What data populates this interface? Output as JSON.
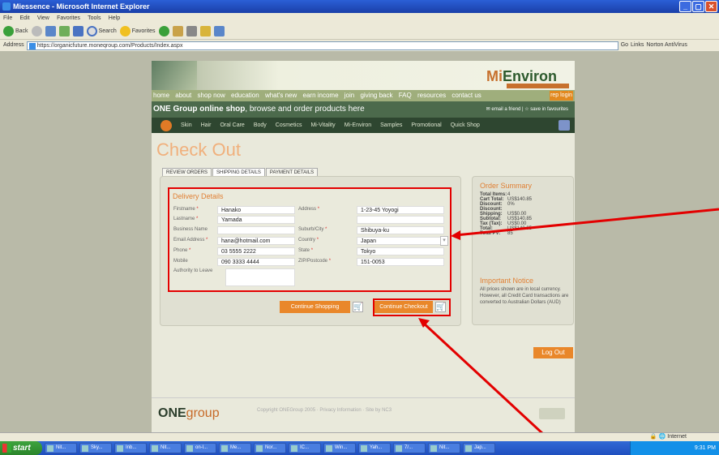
{
  "window": {
    "title": "Miessence - Microsoft Internet Explorer",
    "controls": [
      "_",
      "▢",
      "✕"
    ]
  },
  "menu": [
    "File",
    "Edit",
    "View",
    "Favorites",
    "Tools",
    "Help"
  ],
  "toolbar": {
    "back": "Back",
    "search": "Search",
    "favorites": "Favorites"
  },
  "address": {
    "label": "Address",
    "url": "https://organicfuture.moneqroup.com/Products/Index.aspx",
    "go": "Go",
    "links": "Links",
    "norton": "Norton AntiVirus"
  },
  "site": {
    "logo_mi": "Mi",
    "logo_rest": "Environ",
    "nav": [
      "home",
      "about",
      "shop now",
      "education",
      "what's new",
      "earn income",
      "join",
      "giving back",
      "FAQ",
      "resources",
      "contact us"
    ],
    "rep_login": "rep login",
    "shop_title": "ONE Group online shop",
    "shop_sub": ", browse and order products here",
    "shop_links": "✉ email a friend | ☆ save in favourites",
    "categories": [
      "Skin",
      "Hair",
      "Oral Care",
      "Body",
      "Cosmetics",
      "Mi-Vitality",
      "Mi-Environ",
      "Samples",
      "Promotional",
      "Quick Shop"
    ]
  },
  "page": {
    "title": "Check Out",
    "tabs": [
      "REVIEW ORDERS",
      "SHIPPING DETAILS",
      "PAYMENT DETAILS"
    ],
    "delivery_title": "Delivery Details",
    "fields": {
      "firstname_label": "Firstname",
      "firstname": "Hanako",
      "lastname_label": "Lastname",
      "lastname": "Yamada",
      "business_label": "Business Name",
      "business": "",
      "email_label": "Email Address",
      "email": "hana@hotmail.com",
      "phone_label": "Phone",
      "phone": "03 5555 2222",
      "mobile_label": "Mobile",
      "mobile": "090 3333 4444",
      "authority_label": "Authority to Leave",
      "address_label": "Address",
      "address": "1-23-45 Yoyogi",
      "suburb_label": "Suburb/City",
      "suburb": "Shibuya-ku",
      "country_label": "Country",
      "country": "Japan",
      "state_label": "State",
      "state": "Tokyo",
      "zip_label": "ZIP/Postcode",
      "zip": "151-0053"
    },
    "continue_shopping": "Continue Shopping",
    "continue_checkout": "Continue Checkout",
    "logout": "Log Out"
  },
  "summary": {
    "title": "Order Summary",
    "rows": [
      {
        "label": "Total Items:",
        "value": "4"
      },
      {
        "label": "Cart Total:",
        "value": "US$140.85"
      },
      {
        "label": "Discount:",
        "value": "0%"
      },
      {
        "label": "Discount:",
        "value": ""
      },
      {
        "label": "Shipping:",
        "value": "US$0.00"
      },
      {
        "label": "Subtotal:",
        "value": "US$140.85"
      },
      {
        "label": "Tax (Tax):",
        "value": "US$0.00"
      },
      {
        "label": "Total:",
        "value": "US$140.85"
      },
      {
        "label": "Total PV:",
        "value": "85"
      }
    ],
    "notice_title": "Important Notice",
    "notice_text": "All prices shown are in local currency. However, all Credit Card transactions are converted to Australian Dollars (AUD)"
  },
  "footer": {
    "one": "ONE",
    "group": "group",
    "copyright": "Copyright ONEGroup 2005 · Privacy Information · Site by NC3"
  },
  "status": {
    "zone": "Internet"
  },
  "taskbar": {
    "start": "start",
    "tasks": [
      "Nit...",
      "Sky...",
      "Inb...",
      "Nit...",
      "on-l...",
      "Me...",
      "Nor...",
      "IC...",
      "Win...",
      "Yah...",
      "7/...",
      "Nit...",
      "Jap..."
    ],
    "clock": "9:31 PM"
  },
  "colors": {
    "accent": "#e9872a",
    "nav_green": "#9fae7c",
    "dark_green": "#2e4630",
    "highlight": "#e30000"
  }
}
